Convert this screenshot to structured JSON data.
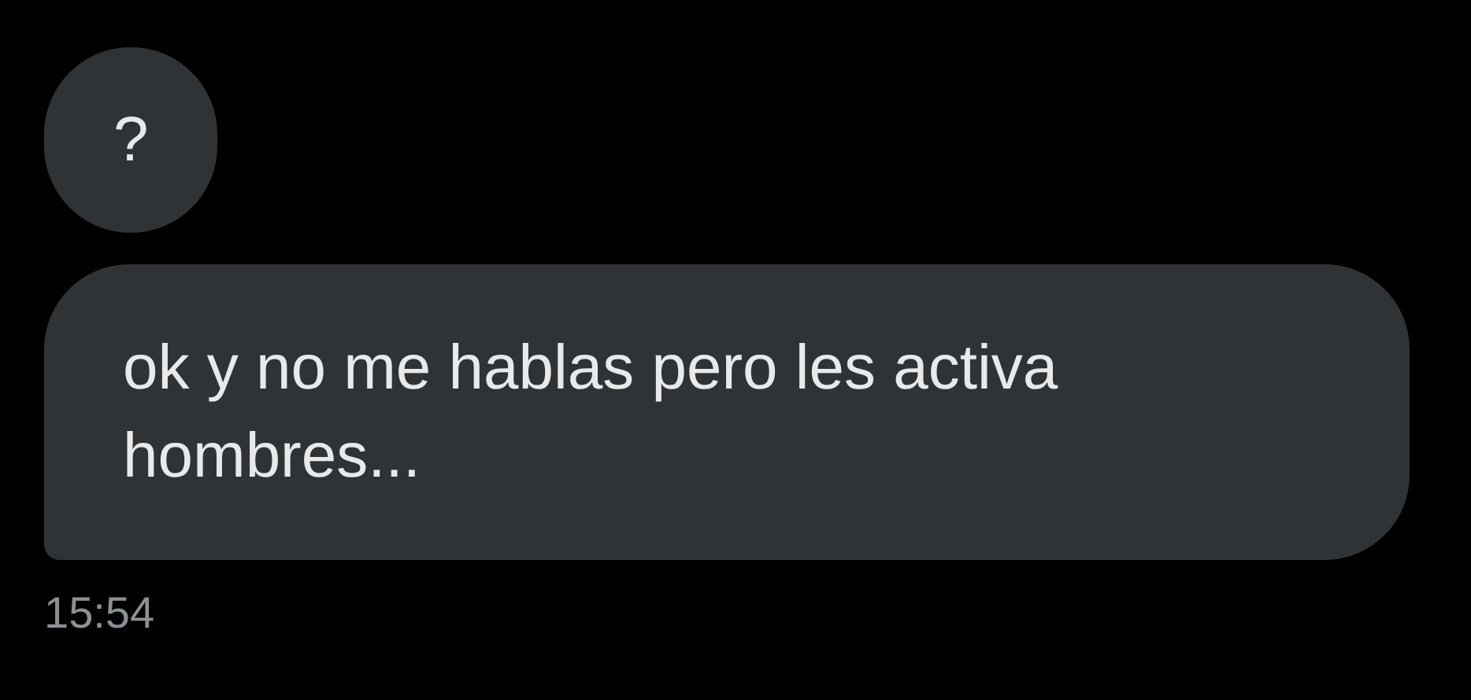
{
  "messages": [
    {
      "text": "?"
    },
    {
      "text": "ok y no me hablas pero les activa hombres..."
    }
  ],
  "timestamp": "15:54"
}
